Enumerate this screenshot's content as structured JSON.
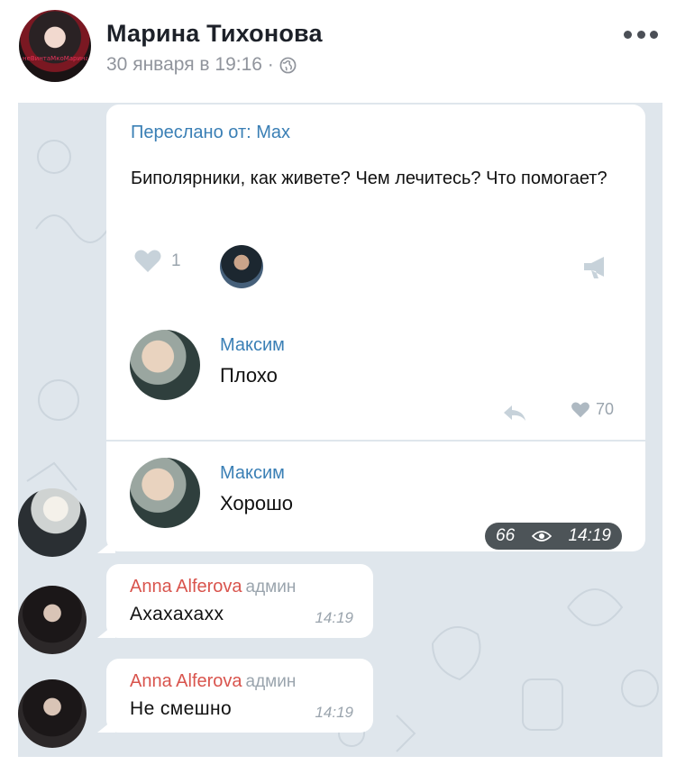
{
  "post": {
    "author_name": "Марина Тихонова",
    "date": "30 января в 19:16 ·",
    "avatar_caption": "неВинтаМкоМарина"
  },
  "chat": {
    "forward": {
      "label": "Переслано от: Max",
      "text": "Биполярники, как живете? Чем лечитесь? Что помогает?",
      "reaction_count": "1"
    },
    "comments": [
      {
        "author": "Максим",
        "text": "Плохо",
        "likes": "70"
      },
      {
        "author": "Максим",
        "text": "Хорошо",
        "views": "66",
        "time": "14:19"
      }
    ],
    "messages": [
      {
        "author": "Anna Alferova",
        "role": "админ",
        "text": "Ахахахахх",
        "time": "14:19"
      },
      {
        "author": "Anna Alferova",
        "role": "админ",
        "text": "Не смешно",
        "time": "14:19"
      }
    ]
  },
  "colors": {
    "link_blue": "#3a7fb5",
    "admin_name": "#d9544d",
    "chat_background": "#dfe6ec"
  }
}
